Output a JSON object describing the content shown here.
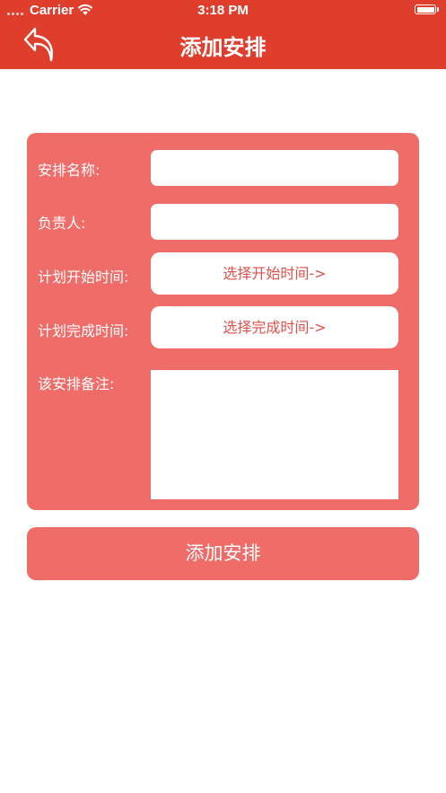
{
  "status_bar": {
    "carrier": "Carrier",
    "time": "3:18 PM"
  },
  "nav": {
    "title": "添加安排",
    "back_icon": "back-arrow-icon"
  },
  "form": {
    "name_label": "安排名称:",
    "name_value": "",
    "owner_label": "负责人:",
    "owner_value": "",
    "start_label": "计划开始时间:",
    "start_button": "选择开始时间->",
    "end_label": "计划完成时间:",
    "end_button": "选择完成时间->",
    "notes_label": "该安排备注:",
    "notes_value": ""
  },
  "submit_label": "添加安排",
  "colors": {
    "header": "#e03e2d",
    "card": "#f06c69",
    "button_text": "#e0504a"
  }
}
